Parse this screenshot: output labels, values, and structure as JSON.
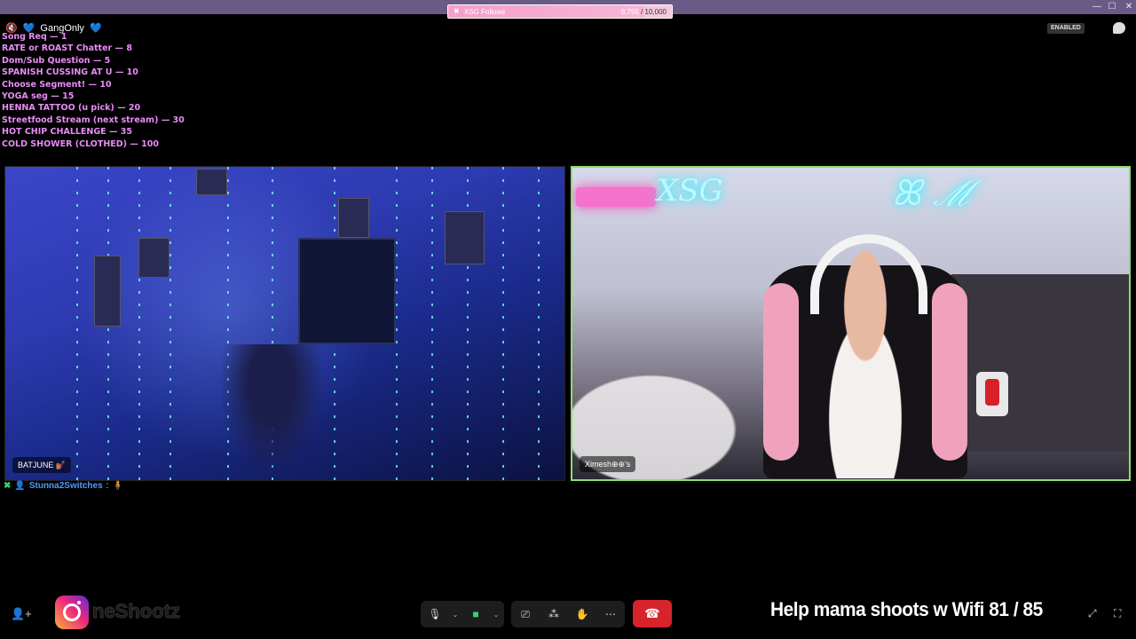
{
  "titlebar": {
    "follow_goal": {
      "label": "XSG Follows",
      "current": "8,755",
      "target": "10,000",
      "progress": 0.8755
    },
    "window_buttons": [
      "—",
      "☐",
      "✕"
    ]
  },
  "overlay": {
    "channel": "GangOnly",
    "menu": [
      "Song Req — 1",
      "RATE or ROAST Chatter — 8",
      "Dom/Sub Question — 5",
      "SPANISH CUSSING AT U — 10",
      "Choose Segment! — 10",
      "YOGA seg — 15",
      "HENNA TATTOO (u pick) — 20",
      "Streetfood Stream (next stream) — 30",
      "HOT CHIP CHALLENGE — 35",
      "COLD SHOWER (CLOTHED) — 100"
    ],
    "enabled_badge": "ENABLED"
  },
  "tiles": {
    "left_name": "BATJUNE 💅🏽",
    "right_name": "Ximesh⊕⊕'s",
    "active_color": "#8fdc6e"
  },
  "chat": {
    "user": "Stunna2Switches",
    "separator": ":"
  },
  "bottom": {
    "instagram_handle": "neShootz",
    "goal_text": "Help mama shoots w Wifi  81 / 85",
    "icons": [
      "add-user-icon",
      "microphone-icon",
      "camera-icon",
      "screen-share-icon",
      "grid-icon",
      "effects-icon",
      "more-icon",
      "hangup-icon",
      "expand-icon",
      "fullscreen-icon"
    ]
  }
}
